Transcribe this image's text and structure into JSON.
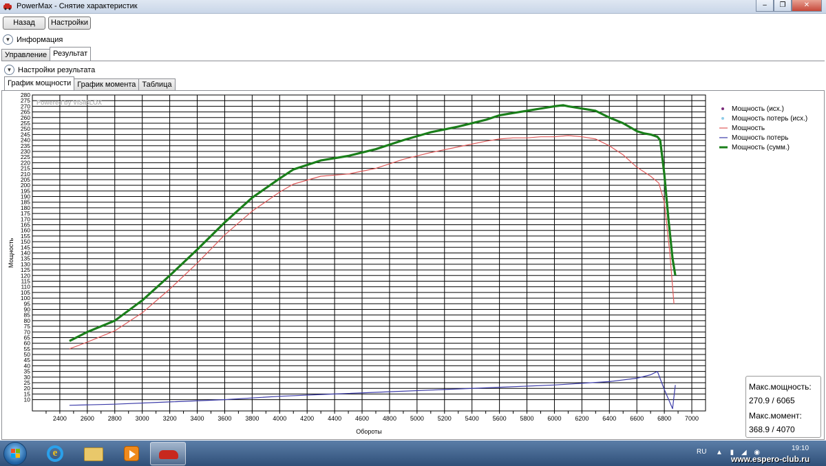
{
  "window": {
    "title": "PowerMax - Снятие характеристик",
    "controls": [
      "minimize-icon",
      "maximize-icon",
      "close-icon"
    ]
  },
  "toolbar": {
    "back_label": "Назад",
    "settings_label": "Настройки"
  },
  "info_expander": {
    "label": "Информация",
    "icon": "chevron-down-icon"
  },
  "main_tabs": [
    {
      "label": "Управление",
      "active": false
    },
    {
      "label": "Результат",
      "active": true
    }
  ],
  "result_settings": {
    "label": "Настройки результата",
    "icon": "chevron-down-icon"
  },
  "chart_tabs": [
    {
      "label": "График мощности",
      "active": true
    },
    {
      "label": "График момента",
      "active": false
    },
    {
      "label": "Таблица",
      "active": false
    }
  ],
  "watermark_logo": "Powered by VISIBLOX",
  "chart_data": {
    "type": "line",
    "xlabel": "Обороты",
    "ylabel": "Мощность",
    "xlim": [
      2200,
      7100
    ],
    "ylim": [
      0,
      280
    ],
    "x_ticks": [
      2400,
      2600,
      2800,
      3000,
      3200,
      3400,
      3600,
      3800,
      4000,
      4200,
      4400,
      4600,
      4800,
      5000,
      5200,
      5400,
      5600,
      5800,
      6000,
      6200,
      6400,
      6600,
      6800,
      7000
    ],
    "y_ticks": [
      10,
      15,
      20,
      25,
      30,
      35,
      40,
      45,
      50,
      55,
      60,
      65,
      70,
      75,
      80,
      85,
      90,
      95,
      100,
      105,
      110,
      115,
      120,
      125,
      130,
      135,
      140,
      145,
      150,
      155,
      160,
      165,
      170,
      175,
      180,
      185,
      190,
      195,
      200,
      205,
      210,
      215,
      220,
      225,
      230,
      235,
      240,
      245,
      250,
      255,
      260,
      265,
      270,
      275,
      280
    ],
    "grid": true,
    "legend_position": "top-right",
    "legend": [
      {
        "name": "Мощность (исх.)",
        "color": "#7a2a7a",
        "style": "dot"
      },
      {
        "name": "Мощность потерь (исх.)",
        "color": "#8fcde8",
        "style": "dot"
      },
      {
        "name": "Мощность",
        "color": "#e05a5a",
        "style": "line"
      },
      {
        "name": "Мощность потерь",
        "color": "#3a3aa8",
        "style": "line"
      },
      {
        "name": "Мощность (сумм.)",
        "color": "#1a7f1a",
        "style": "thick-line"
      }
    ],
    "series": [
      {
        "name": "Мощность",
        "color": "#e05a5a",
        "x": [
          2470,
          2600,
          2800,
          3000,
          3200,
          3400,
          3600,
          3800,
          4000,
          4100,
          4300,
          4500,
          4700,
          4900,
          5100,
          5300,
          5500,
          5600,
          5700,
          5800,
          5900,
          6000,
          6100,
          6200,
          6300,
          6400,
          6500,
          6600,
          6700,
          6760,
          6800,
          6840,
          6870
        ],
        "y": [
          55,
          61,
          71,
          87,
          108,
          131,
          156,
          177,
          194,
          201,
          208,
          210,
          215,
          223,
          229,
          234,
          239,
          241,
          242,
          242,
          243,
          243,
          244,
          243,
          241,
          235,
          227,
          216,
          208,
          202,
          185,
          140,
          95
        ]
      },
      {
        "name": "Мощность потерь",
        "color": "#3a3aa8",
        "x": [
          2470,
          2800,
          3200,
          3600,
          4000,
          4400,
          4800,
          5200,
          5600,
          6000,
          6400,
          6600,
          6700,
          6750,
          6800,
          6860,
          6880
        ],
        "y": [
          5,
          6,
          8,
          10,
          13,
          15,
          17,
          19,
          21,
          23,
          26,
          29,
          32,
          35,
          19,
          2,
          23
        ]
      },
      {
        "name": "Мощность (сумм.)",
        "color": "#1a7f1a",
        "x": [
          2470,
          2600,
          2800,
          3000,
          3200,
          3400,
          3600,
          3800,
          4000,
          4100,
          4300,
          4500,
          4700,
          4900,
          5100,
          5300,
          5500,
          5600,
          5700,
          5800,
          5900,
          6000,
          6065,
          6100,
          6200,
          6300,
          6400,
          6500,
          6600,
          6650,
          6700,
          6750,
          6770,
          6800,
          6830,
          6860,
          6880
        ],
        "y": [
          62,
          70,
          80,
          98,
          120,
          143,
          167,
          189,
          206,
          214,
          222,
          226,
          232,
          240,
          247,
          252,
          258,
          262,
          264,
          266,
          268,
          270,
          270.9,
          270,
          268,
          266,
          260,
          255,
          248,
          246,
          245,
          243,
          240,
          210,
          170,
          135,
          120
        ]
      }
    ]
  },
  "max_info": {
    "power_label": "Макс.мощность:",
    "power_value": "270.9 / 6065",
    "torque_label": "Макс.момент:",
    "torque_value": "368.9 / 4070"
  },
  "taskbar": {
    "items": [
      "start-icon",
      "ie-icon",
      "explorer-icon",
      "media-player-icon",
      "powermax-icon"
    ],
    "language": "RU",
    "time": "19:10"
  },
  "site_watermark": "www.espero-club.ru"
}
